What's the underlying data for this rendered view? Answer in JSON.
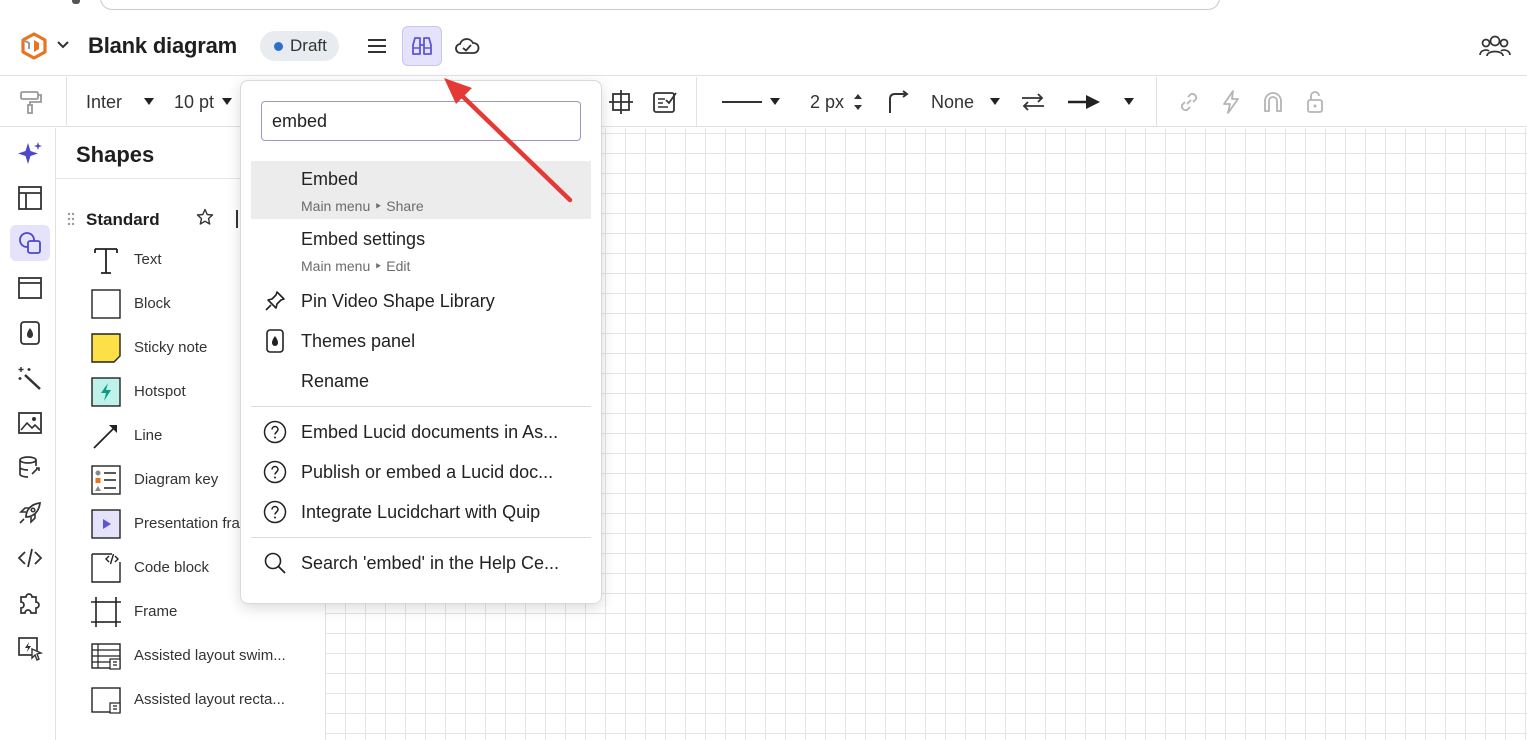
{
  "header": {
    "doc_title": "Blank diagram",
    "status_badge": "Draft",
    "status_color": "#2a72c8",
    "accent_active_bg": "#e4e3fb"
  },
  "toolbar": {
    "font_family": "Inter",
    "font_size": "10 pt",
    "line_width": "2 px",
    "line_start": "None"
  },
  "shapes_panel": {
    "title": "Shapes",
    "section": "Standard",
    "items": [
      {
        "label": "Text",
        "icon": "text-shape-icon"
      },
      {
        "label": "Block",
        "icon": "block-shape-icon"
      },
      {
        "label": "Sticky note",
        "icon": "sticky-note-icon"
      },
      {
        "label": "Hotspot",
        "icon": "hotspot-icon"
      },
      {
        "label": "Line",
        "icon": "line-arrow-icon"
      },
      {
        "label": "Diagram key",
        "icon": "diagram-key-icon"
      },
      {
        "label": "Presentation fra",
        "icon": "presentation-frame-icon"
      },
      {
        "label": "Code block",
        "icon": "code-block-icon"
      },
      {
        "label": "Frame",
        "icon": "frame-icon"
      },
      {
        "label": "Assisted layout swim...",
        "icon": "swimlane-layout-icon"
      },
      {
        "label": "Assisted layout recta...",
        "icon": "rectangle-layout-icon"
      }
    ]
  },
  "search_menu": {
    "query": "embed",
    "results": [
      {
        "title": "Embed",
        "subtitle": "Main menu ‣ Share",
        "icon": ""
      },
      {
        "title": "Embed settings",
        "subtitle": "Main menu ‣ Edit",
        "icon": ""
      },
      {
        "title": "Pin Video Shape Library",
        "subtitle": "",
        "icon": "pin-icon"
      },
      {
        "title": "Themes panel",
        "subtitle": "",
        "icon": "theme-drop-icon"
      },
      {
        "title": "Rename",
        "subtitle": "",
        "icon": ""
      }
    ],
    "help_results": [
      {
        "title": "Embed Lucid documents in As...",
        "icon": "help-circle-icon"
      },
      {
        "title": "Publish or embed a Lucid doc...",
        "icon": "help-circle-icon"
      },
      {
        "title": "Integrate Lucidchart with Quip",
        "icon": "help-circle-icon"
      }
    ],
    "help_center_search": "Search 'embed' in the Help Ce..."
  }
}
